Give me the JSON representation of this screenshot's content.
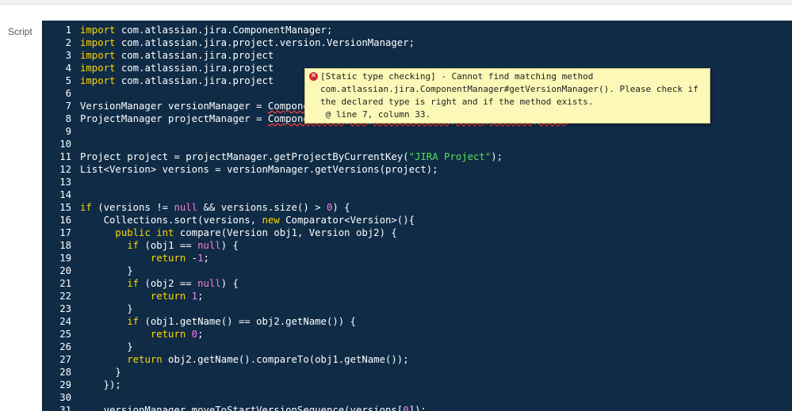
{
  "script_label": "Script",
  "lines": [
    {
      "n": "1",
      "parts": [
        {
          "t": "import",
          "c": "kw"
        },
        {
          "t": " com.atlassian.jira.ComponentManager;"
        }
      ]
    },
    {
      "n": "2",
      "parts": [
        {
          "t": "import",
          "c": "kw"
        },
        {
          "t": " com.atlassian.jira.project.version.VersionManager;"
        }
      ]
    },
    {
      "n": "3",
      "parts": [
        {
          "t": "import",
          "c": "kw"
        },
        {
          "t": " com.atlassian.jira.project"
        }
      ]
    },
    {
      "n": "4",
      "parts": [
        {
          "t": "import",
          "c": "kw"
        },
        {
          "t": " com.atlassian.jira.project"
        }
      ]
    },
    {
      "n": "5",
      "parts": [
        {
          "t": "import",
          "c": "kw"
        },
        {
          "t": " com.atlassian.jira.project"
        }
      ]
    },
    {
      "n": "6",
      "parts": []
    },
    {
      "n": "7",
      "err": true,
      "parts": [
        {
          "t": "VersionManager versionManager = "
        },
        {
          "t": "ComponentManager.getInstance().getVersionManager();",
          "c": "squig"
        }
      ]
    },
    {
      "n": "8",
      "err": true,
      "parts": [
        {
          "t": "ProjectManager projectManager = "
        },
        {
          "t": "ComponentManager.getInstance().getProjectManager();",
          "c": "squig"
        }
      ]
    },
    {
      "n": "9",
      "parts": []
    },
    {
      "n": "10",
      "parts": []
    },
    {
      "n": "11",
      "parts": [
        {
          "t": "Project project = projectManager.getProjectByCurrentKey("
        },
        {
          "t": "\"JIRA Project\"",
          "c": "str"
        },
        {
          "t": ");"
        }
      ]
    },
    {
      "n": "12",
      "parts": [
        {
          "t": "List<Version> versions = versionManager.getVersions(project);"
        }
      ]
    },
    {
      "n": "13",
      "parts": []
    },
    {
      "n": "14",
      "parts": []
    },
    {
      "n": "15",
      "parts": [
        {
          "t": "if",
          "c": "kw"
        },
        {
          "t": " (versions != "
        },
        {
          "t": "null",
          "c": "tk"
        },
        {
          "t": " && versions.size() > "
        },
        {
          "t": "0",
          "c": "num"
        },
        {
          "t": ") {"
        }
      ]
    },
    {
      "n": "16",
      "parts": [
        {
          "t": "    Collections.sort(versions, "
        },
        {
          "t": "new",
          "c": "kw"
        },
        {
          "t": " Comparator<Version>(){"
        }
      ]
    },
    {
      "n": "17",
      "parts": [
        {
          "t": "      "
        },
        {
          "t": "public",
          "c": "kw"
        },
        {
          "t": " "
        },
        {
          "t": "int",
          "c": "kw"
        },
        {
          "t": " compare(Version obj1, Version obj2) {"
        }
      ]
    },
    {
      "n": "18",
      "parts": [
        {
          "t": "        "
        },
        {
          "t": "if",
          "c": "kw"
        },
        {
          "t": " (obj1 == "
        },
        {
          "t": "null",
          "c": "tk"
        },
        {
          "t": ") {"
        }
      ]
    },
    {
      "n": "19",
      "parts": [
        {
          "t": "            "
        },
        {
          "t": "return",
          "c": "kw"
        },
        {
          "t": " -"
        },
        {
          "t": "1",
          "c": "num"
        },
        {
          "t": ";"
        }
      ]
    },
    {
      "n": "20",
      "parts": [
        {
          "t": "        }"
        }
      ]
    },
    {
      "n": "21",
      "parts": [
        {
          "t": "        "
        },
        {
          "t": "if",
          "c": "kw"
        },
        {
          "t": " (obj2 == "
        },
        {
          "t": "null",
          "c": "tk"
        },
        {
          "t": ") {"
        }
      ]
    },
    {
      "n": "22",
      "parts": [
        {
          "t": "            "
        },
        {
          "t": "return",
          "c": "kw"
        },
        {
          "t": " "
        },
        {
          "t": "1",
          "c": "num"
        },
        {
          "t": ";"
        }
      ]
    },
    {
      "n": "23",
      "parts": [
        {
          "t": "        }"
        }
      ]
    },
    {
      "n": "24",
      "parts": [
        {
          "t": "        "
        },
        {
          "t": "if",
          "c": "kw"
        },
        {
          "t": " (obj1.getName() == obj2.getName()) {"
        }
      ]
    },
    {
      "n": "25",
      "parts": [
        {
          "t": "            "
        },
        {
          "t": "return",
          "c": "kw"
        },
        {
          "t": " "
        },
        {
          "t": "0",
          "c": "num"
        },
        {
          "t": ";"
        }
      ]
    },
    {
      "n": "26",
      "parts": [
        {
          "t": "        }"
        }
      ]
    },
    {
      "n": "27",
      "parts": [
        {
          "t": "        "
        },
        {
          "t": "return",
          "c": "kw"
        },
        {
          "t": " obj2.getName().compareTo(obj1.getName());"
        }
      ]
    },
    {
      "n": "28",
      "parts": [
        {
          "t": "      }"
        }
      ]
    },
    {
      "n": "29",
      "parts": [
        {
          "t": "    });"
        }
      ]
    },
    {
      "n": "30",
      "parts": []
    },
    {
      "n": "31",
      "parts": [
        {
          "t": "    versionManager.moveToStartVersionSequence(versions["
        },
        {
          "t": "0",
          "c": "num"
        },
        {
          "t": "]);"
        }
      ]
    }
  ],
  "tooltip": {
    "lines": [
      "[Static type checking] - Cannot find matching method",
      "com.atlassian.jira.ComponentManager#getVersionManager(). Please check if",
      "the declared type is right and if the method exists.",
      " @ line 7, column 33."
    ]
  }
}
